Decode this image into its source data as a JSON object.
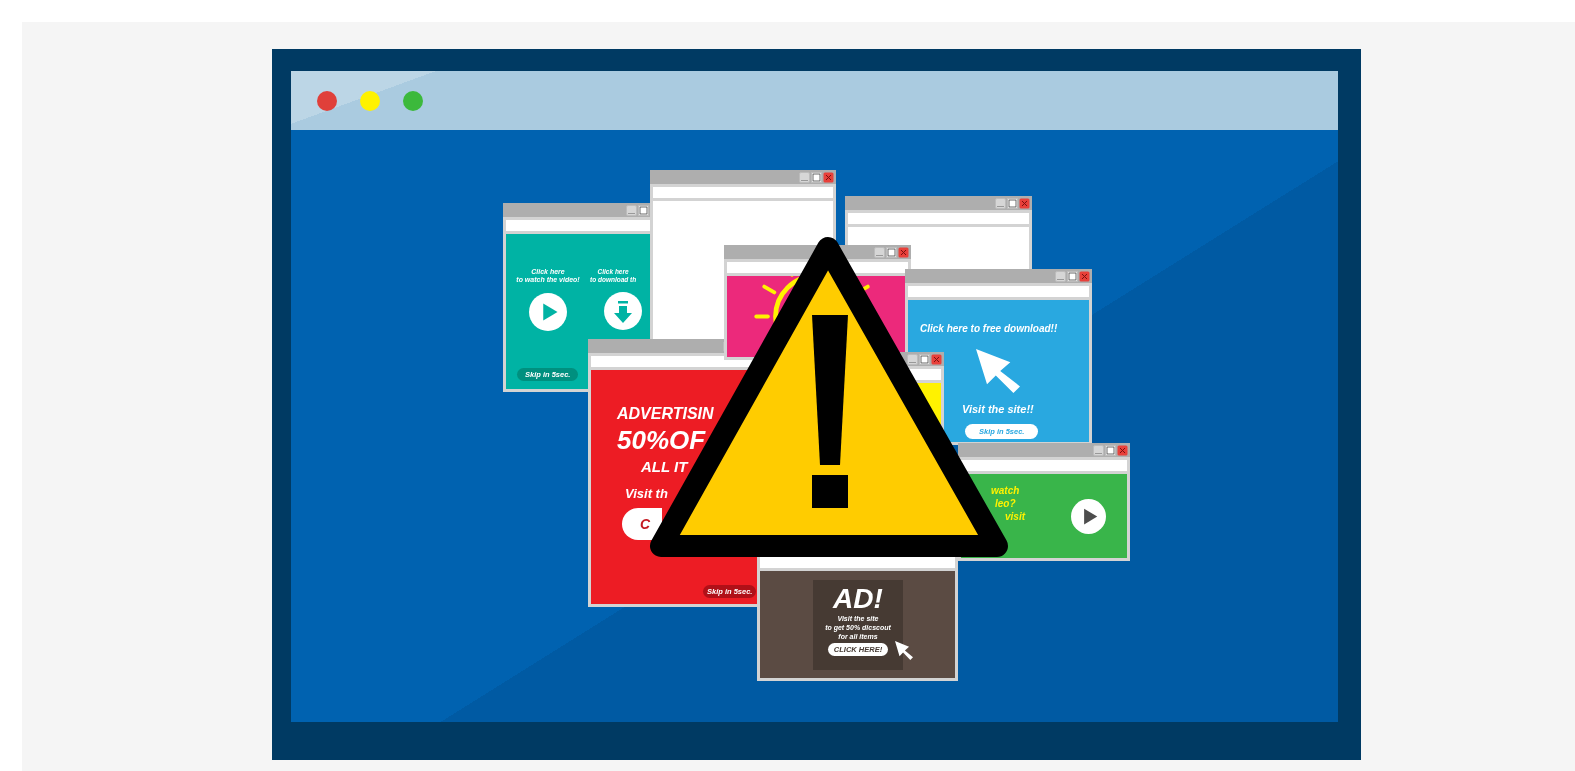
{
  "window": {
    "buttons": [
      {
        "color": "#e0403a"
      },
      {
        "color": "#fff200"
      },
      {
        "color": "#3cb93c"
      }
    ]
  },
  "popups": [
    {
      "kind": "video",
      "color": "#00b3a4",
      "columns": [
        {
          "kind": "play",
          "lines": [
            "Click here",
            "to watch the video!"
          ]
        },
        {
          "kind": "download",
          "lines": [
            "Click here",
            "to download th"
          ]
        }
      ],
      "skip": "Skip in 5sec."
    },
    {
      "kind": "plain",
      "color": "#ffffff"
    },
    {
      "kind": "sale",
      "color": "#ed1c24",
      "lines": [
        "ADVERTISIN",
        "50%OF",
        "ALL IT",
        "Visit th"
      ],
      "button": "C",
      "skip": "Skip in 5sec."
    },
    {
      "kind": "sun",
      "color": "#ec297b"
    },
    {
      "kind": "ad",
      "color": "#5b4b43",
      "title": "AD!",
      "lines": [
        "Visit the site",
        "to get 50% dicscout",
        "for all items"
      ],
      "button": "CLICK HERE!"
    },
    {
      "kind": "plain",
      "color": "#ffffff"
    },
    {
      "kind": "cursor",
      "color": "#29a8e0",
      "headline": "Click here to free download!!",
      "subline": "Visit the site!!",
      "skip": "Skip in 5sec."
    },
    {
      "kind": "plain",
      "color": "#fff200"
    },
    {
      "kind": "play",
      "color": "#39b54a",
      "lines": [
        "watch",
        "leo?",
        "visit"
      ]
    }
  ]
}
